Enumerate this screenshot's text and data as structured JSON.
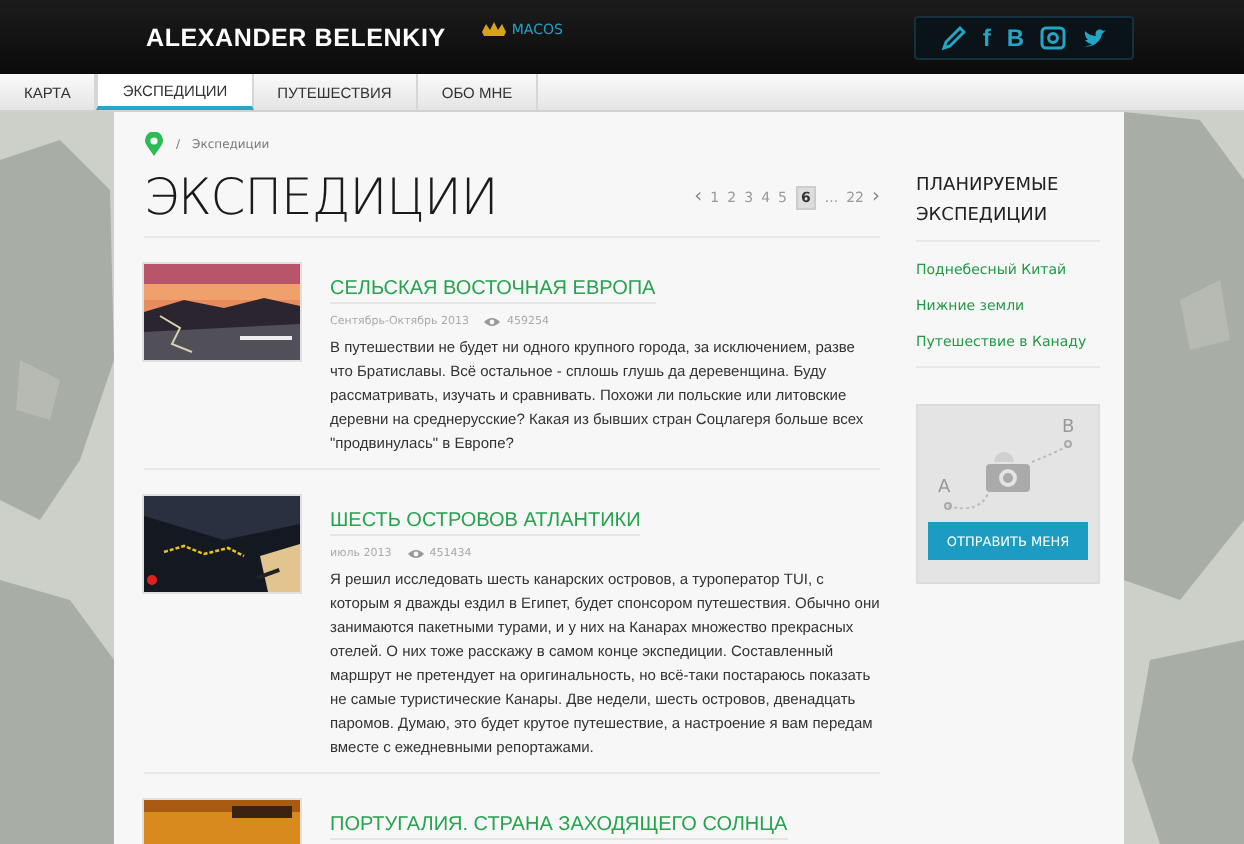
{
  "header": {
    "logo": "ALEXANDER BELENKIY",
    "partner": "MACOS",
    "social": [
      {
        "kind": "pencil"
      },
      {
        "kind": "text",
        "glyph": "f"
      },
      {
        "kind": "text",
        "glyph": "B"
      },
      {
        "kind": "camera"
      },
      {
        "kind": "bird"
      }
    ]
  },
  "nav": [
    {
      "label": "КАРТА",
      "selected": false
    },
    {
      "label": "ЭКСПЕДИЦИИ",
      "selected": true
    },
    {
      "label": "ПУТЕШЕСТВИЯ",
      "selected": false
    },
    {
      "label": "ОБО МНЕ",
      "selected": false
    }
  ],
  "breadcrumb": {
    "separator": "/",
    "current": "Экспедиции"
  },
  "title": "ЭКСПЕДИЦИИ",
  "pagination": {
    "prev": "‹",
    "next": "›",
    "ellipsis": "...",
    "pages": [
      {
        "label": "1",
        "selected": false
      },
      {
        "label": "2",
        "selected": false
      },
      {
        "label": "3",
        "selected": false
      },
      {
        "label": "4",
        "selected": false
      },
      {
        "label": "5",
        "selected": false
      },
      {
        "label": "6",
        "selected": true
      }
    ],
    "last": "22"
  },
  "articles": [
    {
      "title": "СЕЛЬСКАЯ ВОСТОЧНАЯ ЕВРОПА",
      "date": "Сентябрь-Октябрь 2013",
      "views": "459254",
      "text": "В путешествии не будет ни одного крупного города, за исключением, разве что Братиславы. Всё остальное - сплошь глушь да деревенщина. Буду рассматривать, изучать и сравнивать. Похожи ли польские или литовские деревни на среднерусские? Какая из бывших стран Соцлагеря больше всех \"продвинулась\" в Европе?"
    },
    {
      "title": "ШЕСТЬ ОСТРОВОВ АТЛАНТИКИ",
      "date": "июль 2013",
      "views": "451434",
      "text": "Я решил исследовать шесть канарских островов, а туроператор TUI, с которым я дважды ездил в Египет, будет спонсором путешествия. Обычно они занимаются пакетными турами, и у них на Канарах множество прекрасных отелей. О них тоже расскажу в самом конце экспедиции. Составленный маршрут не претендует на оригинальность, но всё-таки постараюсь показать не самые туристические Канары. Две недели, шесть островов, двенадцать паромов. Думаю, это будет крутое путешествие, а настроение я вам передам вместе с ежедневными репортажами."
    },
    {
      "title": "ПОРТУГАЛИЯ. СТРАНА ЗАХОДЯЩЕГО СОЛНЦА"
    }
  ],
  "sidebar": {
    "heading": "ПЛАНИРУЕМЫЕ ЭКСПЕДИЦИИ",
    "links": [
      "Поднебесный Китай",
      "Нижние земли",
      "Путешествие в Канаду"
    ],
    "widget": {
      "start": "A",
      "end": "B",
      "button": "ОТПРАВИТЬ МЕНЯ"
    }
  }
}
